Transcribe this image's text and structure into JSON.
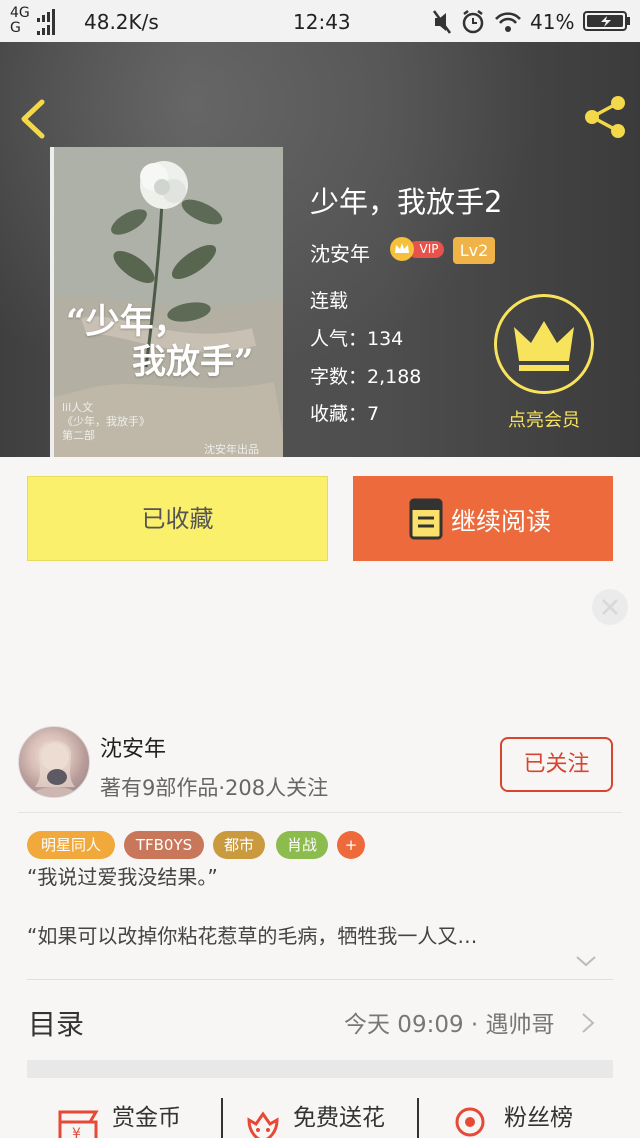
{
  "status_bar": {
    "network_top": "4G",
    "network_bottom": "G",
    "speed": "48.2K/s",
    "time": "12:43",
    "battery": "41%"
  },
  "book": {
    "title": "少年，我放手2",
    "author": "沈安年",
    "vip_label": "VIP",
    "level": "Lv2",
    "status": "连载",
    "popularity": "人气：134",
    "word_count": "字数：2,188",
    "favorites": "收藏：7",
    "cover": {
      "title_line1": "“少年，",
      "title_line2": "我放手”",
      "small_text": "lil人文\n《少年，我放手》\n第二部",
      "small_line1": "lil人文",
      "small_line2": "《少年，我放手》",
      "small_line3": "第二部",
      "author_note": "沈安年出品"
    }
  },
  "vip_cta": {
    "label": "点亮会员"
  },
  "actions": {
    "collected": "已收藏",
    "continue_reading": "继续阅读"
  },
  "author_card": {
    "name": "沈安年",
    "meta": "著有9部作品·208人关注",
    "follow_label": "已关注"
  },
  "tags": [
    {
      "label": "明星同人",
      "color": "#f0a93a"
    },
    {
      "label": "TFB0YS",
      "color": "#c9775a"
    },
    {
      "label": "都市",
      "color": "#c99a3e"
    },
    {
      "label": "肖战",
      "color": "#8cbb4e"
    },
    {
      "label": "+",
      "color": "#ee6a3b"
    }
  ],
  "synopsis": {
    "line1": "“我说过爱我没结果。”",
    "line2": "“如果可以改掉你粘花惹草的毛病，牺牲我一人又…"
  },
  "toc": {
    "label": "目录",
    "update": "今天 09:09 · 遇帅哥"
  },
  "bottom_bar": {
    "reward": "赏金币",
    "flower": "免费送花",
    "fans": "粉丝榜"
  },
  "colors": {
    "accent_orange": "#ec6a3c",
    "collected_yellow": "#fbf06c",
    "vip_yellow": "#f8e35c",
    "follow_red": "#d9442f"
  }
}
